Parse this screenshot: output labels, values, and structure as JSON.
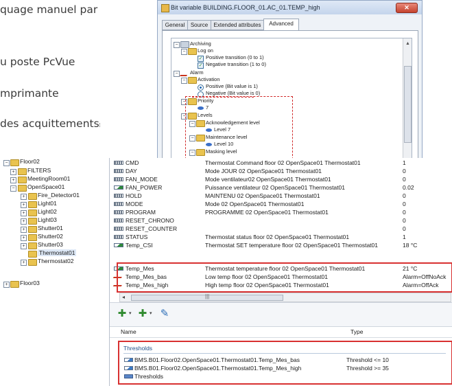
{
  "doc_text": {
    "line1": "quage manuel par",
    "line2": "u poste PcVue",
    "line3": "mprimante",
    "line4": "des acquittements"
  },
  "dialog": {
    "title": "Bit variable BUILDING.FLOOR_01.AC_01.TEMP_high",
    "close_label": "✕",
    "tabs": [
      "General",
      "Source",
      "Extended attributes",
      "Advanced"
    ],
    "active_tab": "Advanced",
    "tree": [
      {
        "label": "Archiving",
        "icon": "archive-icon"
      },
      {
        "label": "Log on",
        "icon": "folder-icon"
      },
      {
        "label": "Positive transition (0 to 1)",
        "icon": "checkbox-checked-icon"
      },
      {
        "label": "Negative transition (1 to 0)",
        "icon": "checkbox-checked-icon"
      },
      {
        "label": "Alarm",
        "icon": "alarm-icon"
      },
      {
        "label": "Activation",
        "icon": "folder-icon"
      },
      {
        "label": "Positive (Bit value is 1)",
        "icon": "radio-selected-icon"
      },
      {
        "label": "Negative (Bit value is 0)",
        "icon": "radio-icon"
      },
      {
        "label": "Priority",
        "icon": "folder-icon"
      },
      {
        "label": "7",
        "icon": "level-icon"
      },
      {
        "label": "Levels",
        "icon": "folder-icon"
      },
      {
        "label": "Acknowledgement level",
        "icon": "folder-icon"
      },
      {
        "label": "Level 7",
        "icon": "level-icon"
      },
      {
        "label": "Maintenance level",
        "icon": "folder-icon"
      },
      {
        "label": "Level 10",
        "icon": "level-icon"
      },
      {
        "label": "Masking level",
        "icon": "folder-icon"
      }
    ]
  },
  "side_tree": [
    {
      "label": "Floor02"
    },
    {
      "label": "FILTERS"
    },
    {
      "label": "MeetingRoom01"
    },
    {
      "label": "OpenSpace01"
    },
    {
      "label": "Fire_Detector01"
    },
    {
      "label": "Light01"
    },
    {
      "label": "Light02"
    },
    {
      "label": "Light03"
    },
    {
      "label": "Shutter01"
    },
    {
      "label": "Shutter02"
    },
    {
      "label": "Shutter03"
    },
    {
      "label": "Thermostat01"
    },
    {
      "label": "Thermostat02"
    },
    {
      "label": "Floor03"
    }
  ],
  "variables": [
    {
      "name": "CMD",
      "description": "Thermostat Command floor 02 OpenSpace01 Thermostat01",
      "value": "1",
      "icon": "register-icon"
    },
    {
      "name": "DAY",
      "description": "Mode JOUR 02 OpenSpace01 Thermostat01",
      "value": "0",
      "icon": "register-icon"
    },
    {
      "name": "FAN_MODE",
      "description": "Mode ventilateur02 OpenSpace01 Thermostat01",
      "value": "0",
      "icon": "register-icon"
    },
    {
      "name": "FAN_POWER",
      "description": "Puissance ventilateur 02 OpenSpace01 Thermostat01",
      "value": "0.02",
      "icon": "measure-icon"
    },
    {
      "name": "HOLD",
      "description": "MAINTENU 02 OpenSpace01 Thermostat01",
      "value": "0",
      "icon": "register-icon"
    },
    {
      "name": "MODE",
      "description": "Mode 02 OpenSpace01 Thermostat01",
      "value": "0",
      "icon": "register-icon"
    },
    {
      "name": "PROGRAM",
      "description": "PROGRAMME 02 OpenSpace01 Thermostat01",
      "value": "0",
      "icon": "register-icon"
    },
    {
      "name": "RESET_CHRONO",
      "description": "",
      "value": "0",
      "icon": "register-icon"
    },
    {
      "name": "RESET_COUNTER",
      "description": "",
      "value": "0",
      "icon": "register-icon"
    },
    {
      "name": "STATUS",
      "description": "Thermostat status floor 02 OpenSpace01 Thermostat01",
      "value": "1",
      "icon": "register-icon"
    },
    {
      "name": "Temp_CSI",
      "description": "Thermostat SET temperature floor 02 OpenSpace01 Thermostat01",
      "value": "18 °C",
      "icon": "measure-icon"
    },
    {
      "name": "Temp_Mes",
      "description": "Thermostat temperature floor 02 OpenSpace01 Thermostat01",
      "value": "21 °C",
      "icon": "measure-icon"
    },
    {
      "name": "Temp_Mes_bas",
      "description": "Low temp floor 02 OpenSpace01 Thermostat01",
      "value": "Alarm=OffNoAck",
      "icon": "alarm-icon"
    },
    {
      "name": "Temp_Mes_high",
      "description": "High temp floor 02 OpenSpace01 Thermostat01",
      "value": "Alarm=OffAck",
      "icon": "alarm-icon"
    }
  ],
  "scroll_mid_glyph": "|||",
  "toolbar": {
    "buttons": [
      {
        "name": "add-variable-button",
        "glyph": "✚"
      },
      {
        "name": "add-threshold-button",
        "glyph": "✚"
      },
      {
        "name": "edit-button",
        "glyph": "✎"
      }
    ]
  },
  "details": {
    "col_name": "Name",
    "col_type": "Type",
    "group_title": "Thresholds",
    "rows": [
      {
        "name": "BMS.B01.Floor02.OpenSpace01.Thermostat01.Temp_Mes_bas",
        "type": "Threshold <= 10",
        "icon": "threshold-icon"
      },
      {
        "name": "BMS.B01.Floor02.OpenSpace01.Thermostat01.Temp_Mes_high",
        "type": "Threshold >= 35",
        "icon": "threshold-icon"
      },
      {
        "name": "Thresholds",
        "type": "",
        "icon": "thresholds-icon"
      }
    ]
  }
}
